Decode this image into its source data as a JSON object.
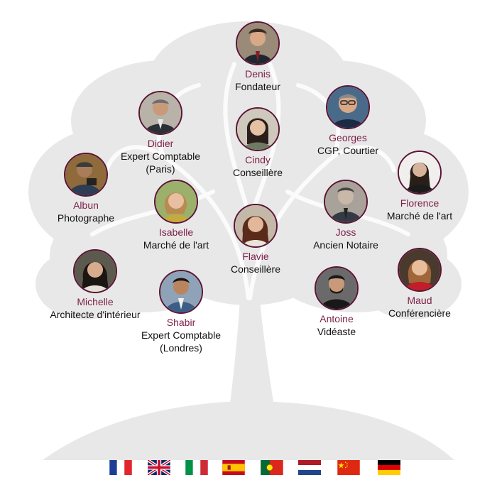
{
  "colors": {
    "accent": "#7a1f47",
    "ring": "#5a1535",
    "tree": "#e7e6e6",
    "text": "#111111"
  },
  "members": [
    {
      "id": "denis",
      "name": "Denis",
      "role": "Fondateur"
    },
    {
      "id": "didier",
      "name": "Didier",
      "role": "Expert Comptable\n(Paris)"
    },
    {
      "id": "georges",
      "name": "Georges",
      "role": "CGP, Courtier"
    },
    {
      "id": "cindy",
      "name": "Cindy",
      "role": "Conseillère"
    },
    {
      "id": "albun",
      "name": "Albun",
      "role": "Photographe"
    },
    {
      "id": "florence",
      "name": "Florence",
      "role": "Marché de l'art"
    },
    {
      "id": "isabelle",
      "name": "Isabelle",
      "role": "Marché de l'art"
    },
    {
      "id": "joss",
      "name": "Joss",
      "role": "Ancien Notaire"
    },
    {
      "id": "flavie",
      "name": "Flavie",
      "role": "Conseillère"
    },
    {
      "id": "michelle",
      "name": "Michelle",
      "role": "Architecte d'intérieur"
    },
    {
      "id": "shabir",
      "name": "Shabir",
      "role": "Expert Comptable\n(Londres)"
    },
    {
      "id": "antoine",
      "name": "Antoine",
      "role": "Vidéaste"
    },
    {
      "id": "maud",
      "name": "Maud",
      "role": "Conférencière"
    }
  ],
  "flags": [
    "france-flag",
    "uk-flag",
    "italy-flag",
    "spain-flag",
    "portugal-flag",
    "netherlands-flag",
    "china-flag",
    "germany-flag"
  ]
}
